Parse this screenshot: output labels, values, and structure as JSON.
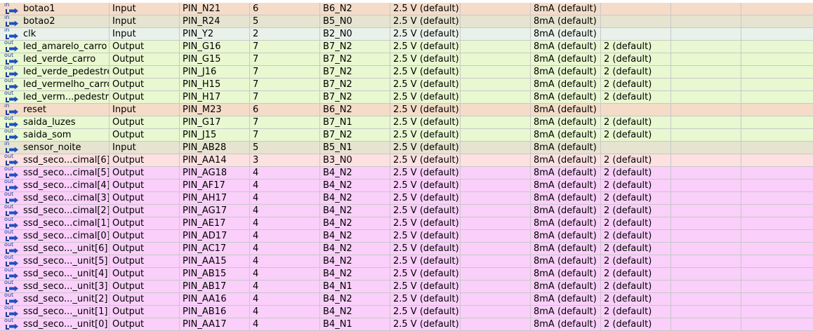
{
  "pins": [
    {
      "name": "botao1",
      "dir": "Input",
      "icon": "input-pin-icon",
      "icon_label": "in",
      "loc": "PIN_N21",
      "bank": "6",
      "vref": "B6_N2",
      "std": "2.5 V (default)",
      "res": "",
      "current": "8mA (default)",
      "slew": "",
      "row_color": "tan"
    },
    {
      "name": "botao2",
      "dir": "Input",
      "icon": "input-pin-icon",
      "icon_label": "in",
      "loc": "PIN_R24",
      "bank": "5",
      "vref": "B5_N0",
      "std": "2.5 V (default)",
      "res": "",
      "current": "8mA (default)",
      "slew": "",
      "row_color": "khaki"
    },
    {
      "name": "clk",
      "dir": "Input",
      "icon": "input-pin-icon",
      "icon_label": "in",
      "loc": "PIN_Y2",
      "bank": "2",
      "vref": "B2_N0",
      "std": "2.5 V (default)",
      "res": "",
      "current": "8mA (default)",
      "slew": "",
      "row_color": "mint"
    },
    {
      "name": "led_amarelo_carro",
      "dir": "Output",
      "icon": "output-pin-icon",
      "icon_label": "out",
      "loc": "PIN_G16",
      "bank": "7",
      "vref": "B7_N2",
      "std": "2.5 V (default)",
      "res": "",
      "current": "8mA (default)",
      "slew": "2 (default)",
      "row_color": "green"
    },
    {
      "name": "led_verde_carro",
      "dir": "Output",
      "icon": "output-pin-icon",
      "icon_label": "out",
      "loc": "PIN_G15",
      "bank": "7",
      "vref": "B7_N2",
      "std": "2.5 V (default)",
      "res": "",
      "current": "8mA (default)",
      "slew": "2 (default)",
      "row_color": "green"
    },
    {
      "name": "led_verde_pedestre",
      "dir": "Output",
      "icon": "output-pin-icon",
      "icon_label": "out",
      "loc": "PIN_J16",
      "bank": "7",
      "vref": "B7_N2",
      "std": "2.5 V (default)",
      "res": "",
      "current": "8mA (default)",
      "slew": "2 (default)",
      "row_color": "green"
    },
    {
      "name": "led_vermelho_carro",
      "dir": "Output",
      "icon": "output-pin-icon",
      "icon_label": "out",
      "loc": "PIN_H15",
      "bank": "7",
      "vref": "B7_N2",
      "std": "2.5 V (default)",
      "res": "",
      "current": "8mA (default)",
      "slew": "2 (default)",
      "row_color": "green"
    },
    {
      "name": "led_verm...pedestre",
      "dir": "Output",
      "icon": "output-pin-icon",
      "icon_label": "out",
      "loc": "PIN_H17",
      "bank": "7",
      "vref": "B7_N2",
      "std": "2.5 V (default)",
      "res": "",
      "current": "8mA (default)",
      "slew": "2 (default)",
      "row_color": "green"
    },
    {
      "name": "reset",
      "dir": "Input",
      "icon": "input-pin-icon",
      "icon_label": "in",
      "loc": "PIN_M23",
      "bank": "6",
      "vref": "B6_N2",
      "std": "2.5 V (default)",
      "res": "",
      "current": "8mA (default)",
      "slew": "",
      "row_color": "tan"
    },
    {
      "name": "saida_luzes",
      "dir": "Output",
      "icon": "output-pin-icon",
      "icon_label": "out",
      "loc": "PIN_G17",
      "bank": "7",
      "vref": "B7_N1",
      "std": "2.5 V (default)",
      "res": "",
      "current": "8mA (default)",
      "slew": "2 (default)",
      "row_color": "green"
    },
    {
      "name": "saida_som",
      "dir": "Output",
      "icon": "output-pin-icon",
      "icon_label": "out",
      "loc": "PIN_J15",
      "bank": "7",
      "vref": "B7_N2",
      "std": "2.5 V (default)",
      "res": "",
      "current": "8mA (default)",
      "slew": "2 (default)",
      "row_color": "green"
    },
    {
      "name": "sensor_noite",
      "dir": "Input",
      "icon": "input-pin-icon",
      "icon_label": "in",
      "loc": "PIN_AB28",
      "bank": "5",
      "vref": "B5_N1",
      "std": "2.5 V (default)",
      "res": "",
      "current": "8mA (default)",
      "slew": "",
      "row_color": "khaki"
    },
    {
      "name": "ssd_seco...cimal[6]",
      "dir": "Output",
      "icon": "output-pin-icon",
      "icon_label": "out",
      "loc": "PIN_AA14",
      "bank": "3",
      "vref": "B3_N0",
      "std": "2.5 V (default)",
      "res": "",
      "current": "8mA (default)",
      "slew": "2 (default)",
      "row_color": "pink"
    },
    {
      "name": "ssd_seco...cimal[5]",
      "dir": "Output",
      "icon": "output-pin-icon",
      "icon_label": "out",
      "loc": "PIN_AG18",
      "bank": "4",
      "vref": "B4_N2",
      "std": "2.5 V (default)",
      "res": "",
      "current": "8mA (default)",
      "slew": "2 (default)",
      "row_color": "magenta"
    },
    {
      "name": "ssd_seco...cimal[4]",
      "dir": "Output",
      "icon": "output-pin-icon",
      "icon_label": "out",
      "loc": "PIN_AF17",
      "bank": "4",
      "vref": "B4_N2",
      "std": "2.5 V (default)",
      "res": "",
      "current": "8mA (default)",
      "slew": "2 (default)",
      "row_color": "magenta"
    },
    {
      "name": "ssd_seco...cimal[3]",
      "dir": "Output",
      "icon": "output-pin-icon",
      "icon_label": "out",
      "loc": "PIN_AH17",
      "bank": "4",
      "vref": "B4_N2",
      "std": "2.5 V (default)",
      "res": "",
      "current": "8mA (default)",
      "slew": "2 (default)",
      "row_color": "magenta"
    },
    {
      "name": "ssd_seco...cimal[2]",
      "dir": "Output",
      "icon": "output-pin-icon",
      "icon_label": "out",
      "loc": "PIN_AG17",
      "bank": "4",
      "vref": "B4_N2",
      "std": "2.5 V (default)",
      "res": "",
      "current": "8mA (default)",
      "slew": "2 (default)",
      "row_color": "magenta"
    },
    {
      "name": "ssd_seco...cimal[1]",
      "dir": "Output",
      "icon": "output-pin-icon",
      "icon_label": "out",
      "loc": "PIN_AE17",
      "bank": "4",
      "vref": "B4_N2",
      "std": "2.5 V (default)",
      "res": "",
      "current": "8mA (default)",
      "slew": "2 (default)",
      "row_color": "magenta"
    },
    {
      "name": "ssd_seco...cimal[0]",
      "dir": "Output",
      "icon": "output-pin-icon",
      "icon_label": "out",
      "loc": "PIN_AD17",
      "bank": "4",
      "vref": "B4_N2",
      "std": "2.5 V (default)",
      "res": "",
      "current": "8mA (default)",
      "slew": "2 (default)",
      "row_color": "magenta"
    },
    {
      "name": "ssd_seco..._unit[6]",
      "dir": "Output",
      "icon": "output-pin-icon",
      "icon_label": "out",
      "loc": "PIN_AC17",
      "bank": "4",
      "vref": "B4_N2",
      "std": "2.5 V (default)",
      "res": "",
      "current": "8mA (default)",
      "slew": "2 (default)",
      "row_color": "magenta"
    },
    {
      "name": "ssd_seco..._unit[5]",
      "dir": "Output",
      "icon": "output-pin-icon",
      "icon_label": "out",
      "loc": "PIN_AA15",
      "bank": "4",
      "vref": "B4_N2",
      "std": "2.5 V (default)",
      "res": "",
      "current": "8mA (default)",
      "slew": "2 (default)",
      "row_color": "magenta"
    },
    {
      "name": "ssd_seco..._unit[4]",
      "dir": "Output",
      "icon": "output-pin-icon",
      "icon_label": "out",
      "loc": "PIN_AB15",
      "bank": "4",
      "vref": "B4_N2",
      "std": "2.5 V (default)",
      "res": "",
      "current": "8mA (default)",
      "slew": "2 (default)",
      "row_color": "magenta"
    },
    {
      "name": "ssd_seco..._unit[3]",
      "dir": "Output",
      "icon": "output-pin-icon",
      "icon_label": "out",
      "loc": "PIN_AB17",
      "bank": "4",
      "vref": "B4_N1",
      "std": "2.5 V (default)",
      "res": "",
      "current": "8mA (default)",
      "slew": "2 (default)",
      "row_color": "magenta"
    },
    {
      "name": "ssd_seco..._unit[2]",
      "dir": "Output",
      "icon": "output-pin-icon",
      "icon_label": "out",
      "loc": "PIN_AA16",
      "bank": "4",
      "vref": "B4_N2",
      "std": "2.5 V (default)",
      "res": "",
      "current": "8mA (default)",
      "slew": "2 (default)",
      "row_color": "magenta"
    },
    {
      "name": "ssd_seco..._unit[1]",
      "dir": "Output",
      "icon": "output-pin-icon",
      "icon_label": "out",
      "loc": "PIN_AB16",
      "bank": "4",
      "vref": "B4_N2",
      "std": "2.5 V (default)",
      "res": "",
      "current": "8mA (default)",
      "slew": "2 (default)",
      "row_color": "magenta"
    },
    {
      "name": "ssd_seco..._unit[0]",
      "dir": "Output",
      "icon": "output-pin-icon",
      "icon_label": "out",
      "loc": "PIN_AA17",
      "bank": "4",
      "vref": "B4_N1",
      "std": "2.5 V (default)",
      "res": "",
      "current": "8mA (default)",
      "slew": "2 (default)",
      "row_color": "magenta"
    }
  ]
}
